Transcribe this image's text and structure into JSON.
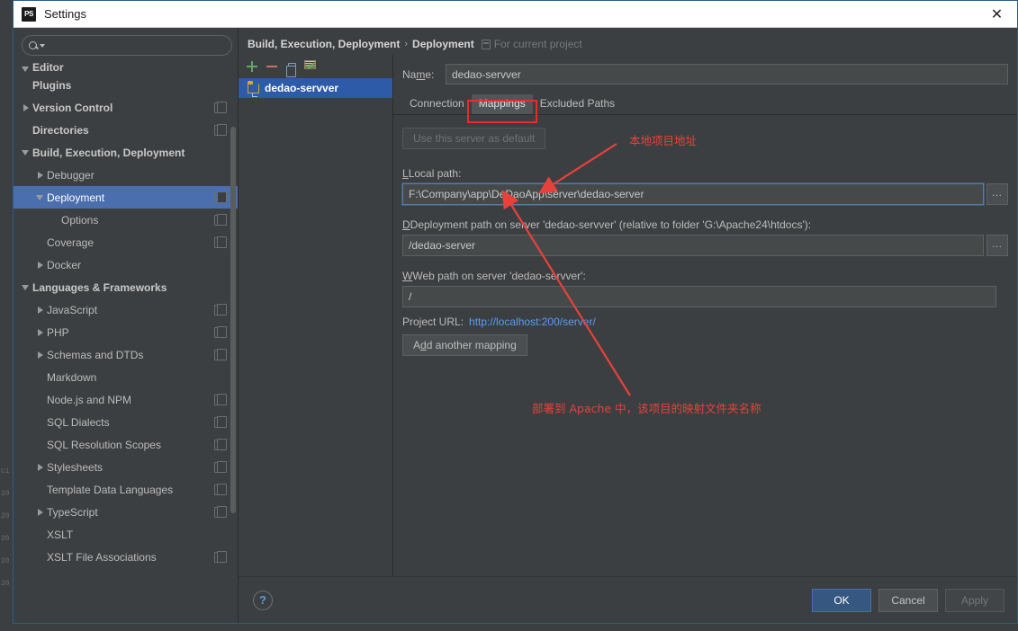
{
  "window": {
    "title": "Settings",
    "app_icon": "phpstorm-icon",
    "close_icon": "close-icon"
  },
  "sidebar": {
    "search": {
      "value": "",
      "placeholder": "",
      "icon": "search-icon"
    },
    "items": [
      {
        "label": "Editor",
        "indent": 1,
        "arrow": "down",
        "bold": true,
        "copy": false,
        "clipped": true
      },
      {
        "label": "Plugins",
        "indent": 1,
        "arrow": "none",
        "bold": true,
        "copy": false
      },
      {
        "label": "Version Control",
        "indent": 1,
        "arrow": "right",
        "bold": true,
        "copy": true
      },
      {
        "label": "Directories",
        "indent": 1,
        "arrow": "none",
        "bold": true,
        "copy": true
      },
      {
        "label": "Build, Execution, Deployment",
        "indent": 1,
        "arrow": "down",
        "bold": true,
        "copy": false
      },
      {
        "label": "Debugger",
        "indent": 2,
        "arrow": "right",
        "bold": false,
        "copy": false
      },
      {
        "label": "Deployment",
        "indent": 2,
        "arrow": "down",
        "bold": false,
        "copy": true,
        "selected": true
      },
      {
        "label": "Options",
        "indent": 3,
        "arrow": "none",
        "bold": false,
        "copy": true
      },
      {
        "label": "Coverage",
        "indent": 2,
        "arrow": "none",
        "bold": false,
        "copy": true
      },
      {
        "label": "Docker",
        "indent": 2,
        "arrow": "right",
        "bold": false,
        "copy": false
      },
      {
        "label": "Languages & Frameworks",
        "indent": 1,
        "arrow": "down",
        "bold": true,
        "copy": false
      },
      {
        "label": "JavaScript",
        "indent": 2,
        "arrow": "right",
        "bold": false,
        "copy": true
      },
      {
        "label": "PHP",
        "indent": 2,
        "arrow": "right",
        "bold": false,
        "copy": true
      },
      {
        "label": "Schemas and DTDs",
        "indent": 2,
        "arrow": "right",
        "bold": false,
        "copy": true
      },
      {
        "label": "Markdown",
        "indent": 2,
        "arrow": "none",
        "bold": false,
        "copy": false
      },
      {
        "label": "Node.js and NPM",
        "indent": 2,
        "arrow": "none",
        "bold": false,
        "copy": true
      },
      {
        "label": "SQL Dialects",
        "indent": 2,
        "arrow": "none",
        "bold": false,
        "copy": true
      },
      {
        "label": "SQL Resolution Scopes",
        "indent": 2,
        "arrow": "none",
        "bold": false,
        "copy": true
      },
      {
        "label": "Stylesheets",
        "indent": 2,
        "arrow": "right",
        "bold": false,
        "copy": true
      },
      {
        "label": "Template Data Languages",
        "indent": 2,
        "arrow": "none",
        "bold": false,
        "copy": true
      },
      {
        "label": "TypeScript",
        "indent": 2,
        "arrow": "right",
        "bold": false,
        "copy": true
      },
      {
        "label": "XSLT",
        "indent": 2,
        "arrow": "none",
        "bold": false,
        "copy": false
      },
      {
        "label": "XSLT File Associations",
        "indent": 2,
        "arrow": "none",
        "bold": false,
        "copy": true
      }
    ]
  },
  "breadcrumb": {
    "root": "Build, Execution, Deployment",
    "separator": "›",
    "current": "Deployment",
    "scope_note": "For current project",
    "scope_icon": "project-scope-icon"
  },
  "server_list": {
    "toolbar": [
      {
        "name": "add-server-button",
        "icon": "plus-icon"
      },
      {
        "name": "remove-server-button",
        "icon": "minus-icon"
      },
      {
        "name": "copy-server-button",
        "icon": "copy-icon"
      },
      {
        "name": "validate-server-button",
        "icon": "check-list-icon"
      }
    ],
    "items": [
      {
        "label": "dedao-servver",
        "icon": "local-server-icon",
        "selected": true
      }
    ]
  },
  "form": {
    "name_label": "Name:",
    "name_value": "dedao-servver",
    "tabs": [
      {
        "label": "Connection",
        "active": false
      },
      {
        "label": "Mappings",
        "active": true
      },
      {
        "label": "Excluded Paths",
        "active": false
      }
    ],
    "use_default_button": "Use this server as default",
    "use_default_disabled": true,
    "local_path_label": "Local path:",
    "local_path_value": "F:\\Company\\app\\DeDaoApp\\server\\dedao-server",
    "deployment_path_label": "Deployment path on server 'dedao-servver' (relative to folder 'G:\\Apache24\\htdocs'):",
    "deployment_path_value": "/dedao-server",
    "web_path_label": "Web path on server 'dedao-servver':",
    "web_path_value": "/",
    "project_url_label": "Project URL:",
    "project_url_value": "http://localhost:200/server/",
    "add_mapping_button": "Add another mapping",
    "browse_button_glyph": "…"
  },
  "footer": {
    "help_label": "?",
    "ok_label": "OK",
    "cancel_label": "Cancel",
    "apply_label": "Apply",
    "apply_disabled": true
  },
  "annotations": {
    "highlight_target": "Mappings",
    "note_local_path": "本地项目地址",
    "note_deploy_folder": "部署到 Apache 中，该项目的映射文件夹名称",
    "color": "#e8413b"
  },
  "background_lines": [
    "ci",
    "20",
    "20",
    "20",
    "20",
    "20"
  ]
}
